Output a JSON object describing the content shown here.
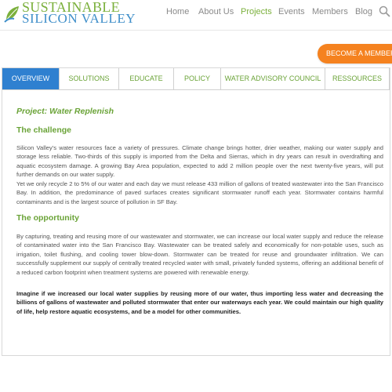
{
  "brand": {
    "line1": "SUSTAINABLE",
    "line2": "SILICON VALLEY",
    "accent_green": "#7bb03c",
    "accent_blue": "#3e8ec9",
    "icon": "leaf-logo-icon"
  },
  "nav": {
    "items": [
      {
        "label": "Home",
        "active": false
      },
      {
        "label": "About Us",
        "active": false
      },
      {
        "label": "Projects",
        "active": true
      },
      {
        "label": "Events",
        "active": false
      },
      {
        "label": "Members",
        "active": false
      },
      {
        "label": "Blog",
        "active": false
      }
    ],
    "search_icon": "search-icon"
  },
  "cta": {
    "become_member": "BECOME A MEMBER",
    "color": "#f5821f"
  },
  "tabs": [
    {
      "label": "OVERVIEW",
      "active": true
    },
    {
      "label": "SOLUTIONS",
      "active": false
    },
    {
      "label": "EDUCATE",
      "active": false
    },
    {
      "label": "POLICY",
      "active": false
    },
    {
      "label": "WATER ADVISORY COUNCIL",
      "active": false
    },
    {
      "label": "RESSOURCES",
      "active": false
    }
  ],
  "content": {
    "project_title": "Project: Water Replenish",
    "challenge_heading": "The challenge",
    "challenge_p1": "Silicon Valley’s water resources face a variety of pressures. Climate change brings hotter, drier weather, making our water supply and storage less reliable. Two-thirds of this supply is imported from the Delta and Sierras, which in dry years can result in overdrafting and aquatic ecosystem damage. A growing Bay Area population, expected to add 2 million people over the next twenty-five years, will put further demands on our water supply.",
    "challenge_p2": "Yet we only recycle 2 to 5% of our water and each day we must release 433 million of gallons of treated wastewater into the San Francisco Bay. In addition, the predominance of paved surfaces creates significant stormwater runoff each year. Stormwater contains harmful contaminants and is the largest source of pollution in SF Bay.",
    "opportunity_heading": "The opportunity",
    "opportunity_p1": "By capturing, treating and reusing more of our wastewater and stormwater, we can increase our local water supply and reduce the release of contaminated water into the San Francisco Bay. Wastewater can be treated safely and economically for non-potable uses, such as irrigation, toilet flushing, and cooling tower blow-down. Stormwater can be treated for reuse and groundwater infiltration. We can successfully supplement our supply of centrally treated recycled water with small, privately funded systems, offering an additional benefit of a reduced carbon footprint when treatment systems are powered with renewable energy.",
    "imagine_p": "Imagine if we increased our local water supplies by reusing more of our water, thus importing less water and decreasing the billions of gallons of wastewater and polluted stormwater that enter our waterways each year. We could maintain our high quality of life, help restore aquatic ecosystems, and be a model for other communities."
  }
}
